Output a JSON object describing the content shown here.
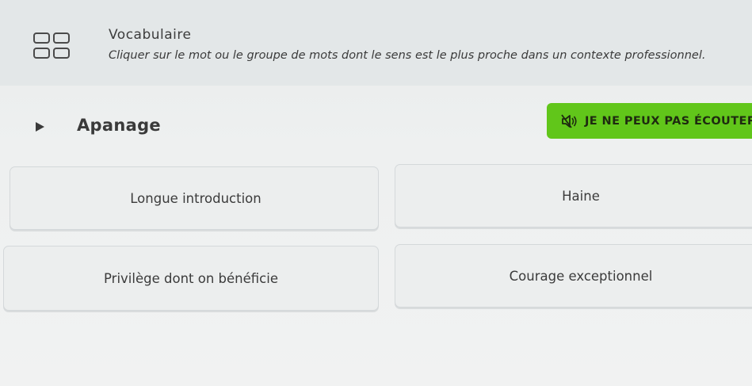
{
  "header": {
    "title": "Vocabulaire",
    "instruction": "Cliquer sur le mot ou le groupe de mots dont le sens est le plus proche dans un contexte professionnel."
  },
  "prompt": {
    "word": "Apanage"
  },
  "cant_listen_label": "JE NE PEUX PAS ÉCOUTER",
  "options": [
    "Longue introduction",
    "Haine",
    "Privilège dont on bénéficie",
    "Courage exceptionnel"
  ],
  "colors": {
    "accent_green": "#61c61a",
    "text": "#3a3a3a",
    "header_bg": "#e3e7e8"
  }
}
